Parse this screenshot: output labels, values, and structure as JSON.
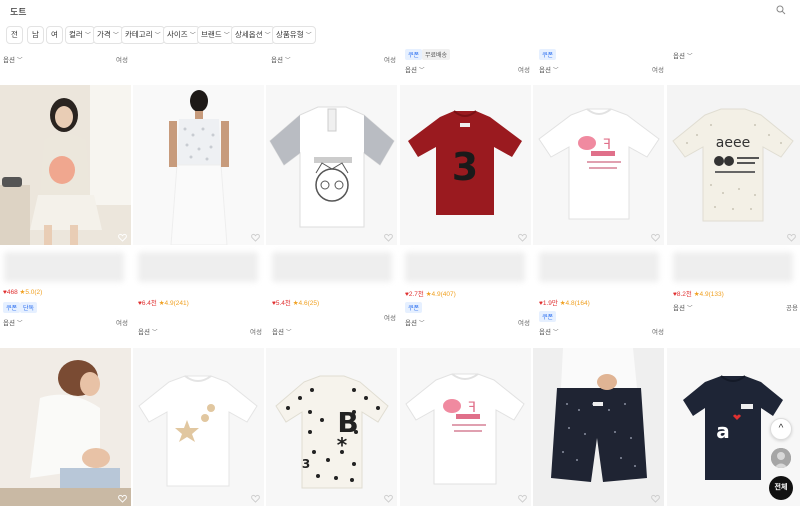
{
  "search": {
    "query": "도트"
  },
  "filters": {
    "all": "전",
    "male": "남",
    "female": "여",
    "color": "컬러",
    "price": "가격",
    "category": "카테고리",
    "size": "사이즈",
    "brand": "브랜드",
    "detail": "상세옵션",
    "type": "상품유형"
  },
  "common": {
    "option_label": "옵션",
    "gender_female": "여성",
    "gender_all": "공용",
    "coupon_badge": "쿠폰",
    "free_ship_badge": "무료배송",
    "exclusive_badge": "단독"
  },
  "row2_meta": [
    {
      "likes": "468",
      "rating": "5.0(2)"
    },
    {
      "likes": "6.4천",
      "rating": "4.9(241)"
    },
    {
      "likes": "5.4천",
      "rating": "4.6(25)"
    },
    {
      "likes": "2.7천",
      "rating": "4.9(407)"
    },
    {
      "likes": "1.9만",
      "rating": "4.8(164)"
    },
    {
      "likes": "8.2천",
      "rating": "4.9(133)"
    }
  ],
  "fab": {
    "scroll_top": "^",
    "all_label": "전체"
  },
  "colors": {
    "likes": "#e03030",
    "rating": "#f0a020",
    "coupon_bg": "#e6f0ff",
    "coupon_text": "#2a6ef0"
  }
}
